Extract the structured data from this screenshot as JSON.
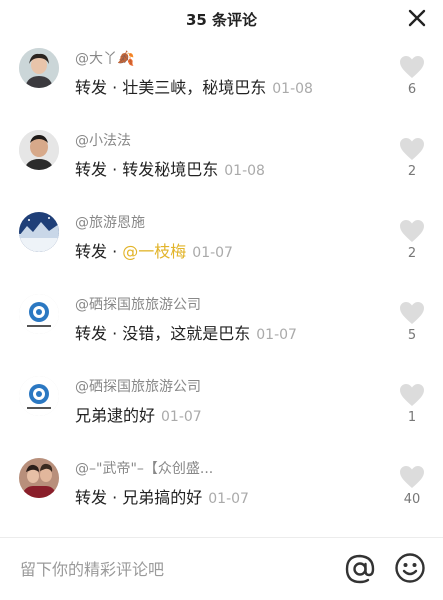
{
  "header": {
    "title": "35 条评论"
  },
  "comments": [
    {
      "user": "@大丫🍂",
      "prefix": "转发 · 壮美三峡，秘境巴东",
      "mention": "",
      "date": "01-08",
      "likes": "6"
    },
    {
      "user": "@小法法",
      "prefix": "转发 · 转发秘境巴东",
      "mention": "",
      "date": "01-08",
      "likes": "2"
    },
    {
      "user": "@旅游恩施",
      "prefix": "转发 · ",
      "mention": "@一枝梅",
      "date": "01-07",
      "likes": "2"
    },
    {
      "user": "@硒探国旅旅游公司",
      "prefix": "转发 · 没错，这就是巴东",
      "mention": "",
      "date": "01-07",
      "likes": "5"
    },
    {
      "user": "@硒探国旅旅游公司",
      "prefix": "兄弟逮的好",
      "mention": "",
      "date": "01-07",
      "likes": "1"
    },
    {
      "user": "@–\"武帝\"–【众创盛...",
      "prefix": "转发 · 兄弟搞的好",
      "mention": "",
      "date": "01-07",
      "likes": "40"
    }
  ],
  "input": {
    "placeholder": "留下你的精彩评论吧"
  },
  "colors": {
    "mention": "#e2b42a",
    "heart": "#dcdcdc",
    "text": "#222222",
    "muted": "#aaaaaa"
  },
  "icons": {
    "close": "close-icon",
    "like": "heart-icon",
    "at": "at-sign-icon",
    "emoji": "smiley-icon"
  }
}
